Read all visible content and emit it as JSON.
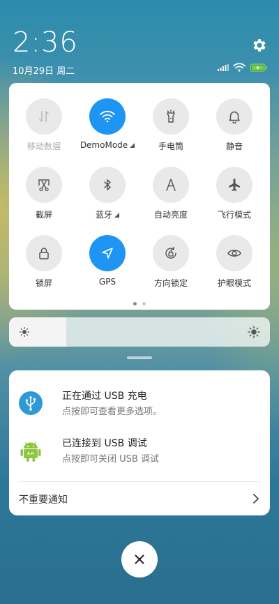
{
  "status": {
    "time": "2:36",
    "date": "10月29日 周二",
    "icons": [
      "signal-icon",
      "wifi-icon",
      "battery-charging-icon"
    ],
    "battery_color": "#7dd23c"
  },
  "quick_settings": {
    "tiles": [
      {
        "label": "移动数据",
        "icon": "mobile-data-icon",
        "active": false,
        "disabled": true
      },
      {
        "label": "DemoMode",
        "icon": "wifi-icon",
        "active": true,
        "has_more": true
      },
      {
        "label": "手电筒",
        "icon": "flashlight-icon",
        "active": false
      },
      {
        "label": "静音",
        "icon": "bell-icon",
        "active": false
      },
      {
        "label": "截屏",
        "icon": "screenshot-icon",
        "active": false
      },
      {
        "label": "蓝牙",
        "icon": "bluetooth-icon",
        "active": false,
        "has_more": true
      },
      {
        "label": "自动亮度",
        "icon": "auto-brightness-icon",
        "active": false
      },
      {
        "label": "飞行模式",
        "icon": "airplane-icon",
        "active": false
      },
      {
        "label": "锁屏",
        "icon": "lock-icon",
        "active": false
      },
      {
        "label": "GPS",
        "icon": "location-icon",
        "active": true
      },
      {
        "label": "方向锁定",
        "icon": "rotation-lock-icon",
        "active": false
      },
      {
        "label": "护眼模式",
        "icon": "eye-icon",
        "active": false
      }
    ],
    "page_count": 2,
    "current_page": 1,
    "accent_color": "#1e95f2"
  },
  "brightness": {
    "level": 0.22
  },
  "notifications": {
    "items": [
      {
        "title": "正在通过 USB 充电",
        "subtitle": "点按即可查看更多选项。",
        "icon": "usb-icon"
      },
      {
        "title": "已连接到 USB 调试",
        "subtitle": "点按即可关闭 USB 调试",
        "icon": "android-icon"
      }
    ],
    "unimportant_label": "不重要通知"
  }
}
